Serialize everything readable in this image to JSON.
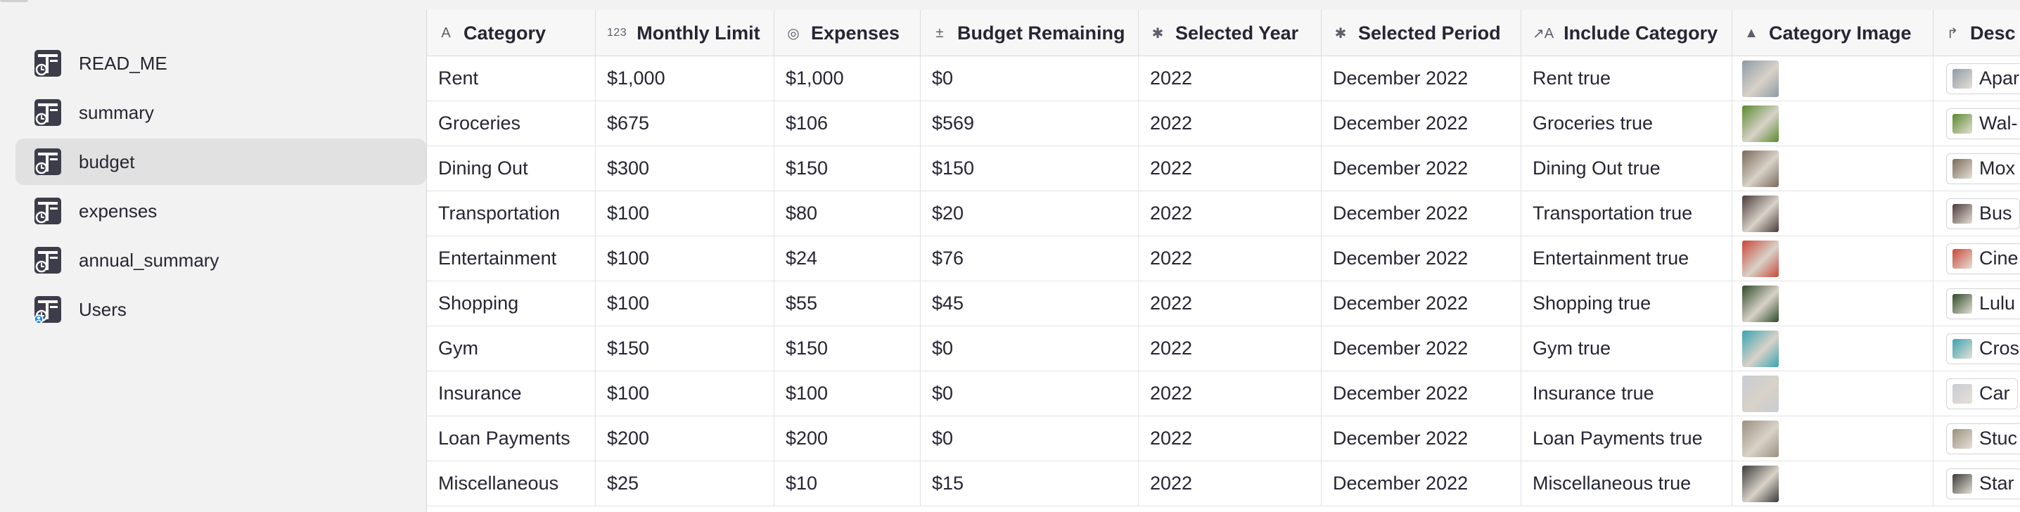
{
  "sidebar": {
    "items": [
      {
        "label": "READ_ME",
        "icon": "table-widget-icon",
        "active": false
      },
      {
        "label": "summary",
        "icon": "table-widget-icon",
        "active": false
      },
      {
        "label": "budget",
        "icon": "table-widget-icon",
        "active": true
      },
      {
        "label": "expenses",
        "icon": "table-widget-icon",
        "active": false
      },
      {
        "label": "annual_summary",
        "icon": "table-widget-icon",
        "active": false
      },
      {
        "label": "Users",
        "icon": "table-widget-icon-with-user-badge",
        "active": false
      }
    ]
  },
  "table": {
    "columns": [
      {
        "label": "Category",
        "type_icon": "text-type-icon",
        "type_glyph": "A"
      },
      {
        "label": "Monthly Limit",
        "type_icon": "numeric-type-icon",
        "type_glyph": "123"
      },
      {
        "label": "Expenses",
        "type_icon": "formula-type-icon",
        "type_glyph": "◎"
      },
      {
        "label": "Budget Remaining",
        "type_icon": "formula-calc-type-icon",
        "type_glyph": "±"
      },
      {
        "label": "Selected Year",
        "type_icon": "any-type-icon",
        "type_glyph": "✱"
      },
      {
        "label": "Selected Period",
        "type_icon": "any-type-icon",
        "type_glyph": "✱"
      },
      {
        "label": "Include Category",
        "type_icon": "text-formula-type-icon",
        "type_glyph": "↗A"
      },
      {
        "label": "Category Image",
        "type_icon": "image-type-icon",
        "type_glyph": "▲"
      },
      {
        "label": "Desc",
        "type_icon": "reference-type-icon",
        "type_glyph": "↱"
      }
    ],
    "rows": [
      {
        "category": "Rent",
        "monthly_limit": "$1,000",
        "expenses": "$1,000",
        "remaining": "$0",
        "year": "2022",
        "period": "December 2022",
        "include": "Rent true",
        "ref": "Apar",
        "img_color": "#8f9aa6"
      },
      {
        "category": "Groceries",
        "monthly_limit": "$675",
        "expenses": "$106",
        "remaining": "$569",
        "year": "2022",
        "period": "December 2022",
        "include": "Groceries true",
        "ref": "Wal-",
        "img_color": "#5a8a2e"
      },
      {
        "category": "Dining Out",
        "monthly_limit": "$300",
        "expenses": "$150",
        "remaining": "$150",
        "year": "2022",
        "period": "December 2022",
        "include": "Dining Out true",
        "ref": "Mox",
        "img_color": "#7a6a5a"
      },
      {
        "category": "Transportation",
        "monthly_limit": "$100",
        "expenses": "$80",
        "remaining": "$20",
        "year": "2022",
        "period": "December 2022",
        "include": "Transportation true",
        "ref": "Bus",
        "img_color": "#4a3a3a"
      },
      {
        "category": "Entertainment",
        "monthly_limit": "$100",
        "expenses": "$24",
        "remaining": "$76",
        "year": "2022",
        "period": "December 2022",
        "include": "Entertainment true",
        "ref": "Cine",
        "img_color": "#c9473a"
      },
      {
        "category": "Shopping",
        "monthly_limit": "$100",
        "expenses": "$55",
        "remaining": "$45",
        "year": "2022",
        "period": "December 2022",
        "include": "Shopping true",
        "ref": "Lulu",
        "img_color": "#2f4a2a"
      },
      {
        "category": "Gym",
        "monthly_limit": "$150",
        "expenses": "$150",
        "remaining": "$0",
        "year": "2022",
        "period": "December 2022",
        "include": "Gym true",
        "ref": "Cros",
        "img_color": "#3aa3b0"
      },
      {
        "category": "Insurance",
        "monthly_limit": "$100",
        "expenses": "$100",
        "remaining": "$0",
        "year": "2022",
        "period": "December 2022",
        "include": "Insurance true",
        "ref": "Car",
        "img_color": "#c8ccd4"
      },
      {
        "category": "Loan Payments",
        "monthly_limit": "$200",
        "expenses": "$200",
        "remaining": "$0",
        "year": "2022",
        "period": "December 2022",
        "include": "Loan Payments true",
        "ref": "Stuc",
        "img_color": "#9a9080"
      },
      {
        "category": "Miscellaneous",
        "monthly_limit": "$25",
        "expenses": "$10",
        "remaining": "$15",
        "year": "2022",
        "period": "December 2022",
        "include": "Miscellaneous true",
        "ref": "Star",
        "img_color": "#3a3a3a"
      }
    ]
  }
}
